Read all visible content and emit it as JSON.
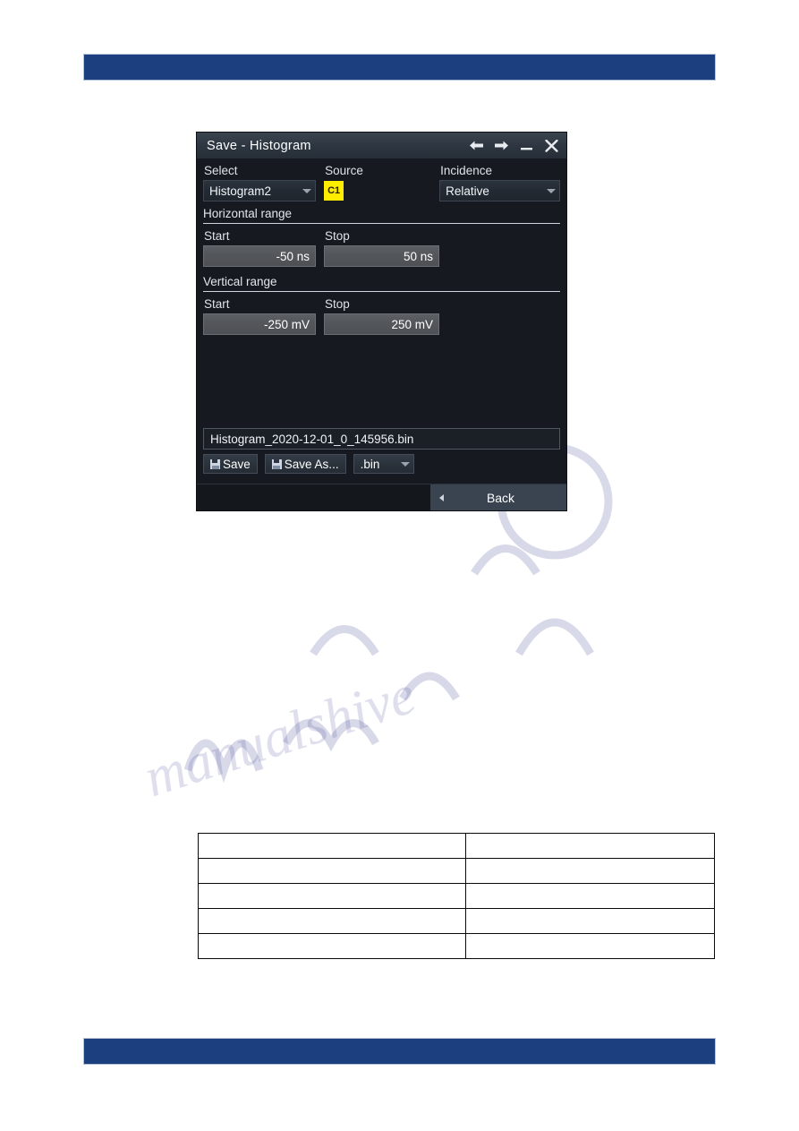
{
  "page": {
    "top_bar_color": "#1c3f7f",
    "bottom_bar_color": "#1c3f7f"
  },
  "dialog": {
    "title": "Save - Histogram",
    "titlebar_buttons": [
      {
        "name": "back-arrow-icon",
        "glyph": "left-arrow"
      },
      {
        "name": "forward-arrow-icon",
        "glyph": "right-arrow"
      },
      {
        "name": "minimize-icon",
        "glyph": "minimize"
      },
      {
        "name": "close-icon",
        "glyph": "close"
      }
    ],
    "select": {
      "label": "Select",
      "value": "Histogram2"
    },
    "source": {
      "label": "Source",
      "value": "C1",
      "badge_color": "#ffec00",
      "badge_text_color": "#26210a"
    },
    "incidence": {
      "label": "Incidence",
      "value": "Relative"
    },
    "horizontal_range": {
      "section_label": "Horizontal range",
      "start_label": "Start",
      "start_value": "-50 ns",
      "stop_label": "Stop",
      "stop_value": "50 ns"
    },
    "vertical_range": {
      "section_label": "Vertical range",
      "start_label": "Start",
      "start_value": "-250 mV",
      "stop_label": "Stop",
      "stop_value": "250 mV"
    },
    "filename": {
      "value": "Histogram_2020-12-01_0_145956.bin"
    },
    "actions": {
      "save_label": "Save",
      "save_as_label": "Save As...",
      "extension_value": ".bin"
    },
    "footer": {
      "back_label": "Back"
    }
  },
  "doc_table": {
    "columns": [
      "",
      ""
    ],
    "rows": [
      [
        "",
        ""
      ],
      [
        "",
        ""
      ],
      [
        "",
        ""
      ],
      [
        "",
        ""
      ],
      [
        "",
        ""
      ]
    ]
  }
}
